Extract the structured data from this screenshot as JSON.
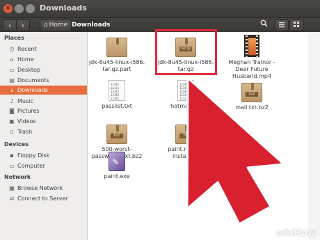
{
  "window": {
    "title": "Downloads"
  },
  "toolbar": {
    "back": "‹",
    "forward": "›",
    "breadcrumb_home": "Home",
    "breadcrumb_current": "Downloads",
    "search_icon": "search-icon",
    "list_view_icon": "list-icon",
    "grid_view_icon": "grid-icon"
  },
  "sidebar": {
    "places_heading": "Places",
    "places": [
      {
        "label": "Recent",
        "icon": "clock-icon"
      },
      {
        "label": "Home",
        "icon": "home-icon"
      },
      {
        "label": "Desktop",
        "icon": "desktop-icon"
      },
      {
        "label": "Documents",
        "icon": "documents-icon"
      },
      {
        "label": "Downloads",
        "icon": "download-icon",
        "active": true
      },
      {
        "label": "Music",
        "icon": "music-icon"
      },
      {
        "label": "Pictures",
        "icon": "pictures-icon"
      },
      {
        "label": "Videos",
        "icon": "videos-icon"
      },
      {
        "label": "Trash",
        "icon": "trash-icon"
      }
    ],
    "devices_heading": "Devices",
    "devices": [
      {
        "label": "Floppy Disk",
        "icon": "floppy-icon"
      },
      {
        "label": "Computer",
        "icon": "computer-icon"
      }
    ],
    "network_heading": "Network",
    "network": [
      {
        "label": "Browse Network",
        "icon": "network-icon"
      },
      {
        "label": "Connect to Server",
        "icon": "server-icon"
      }
    ]
  },
  "files": [
    {
      "name": "jdk-8u45-linux-i586.\ntar.gz.part",
      "type": "archive",
      "tag": ""
    },
    {
      "name": "jdk-8u45-linux-i586.\ntar.gz",
      "type": "archive",
      "tag": "tar.gz"
    },
    {
      "name": "Meghan Trainor -\nDear Future\nHusband.mp4",
      "type": "video"
    },
    {
      "name": "passlist.txt",
      "type": "text",
      "preview": "12345\npassw\n12345\n12345\n12345"
    },
    {
      "name": "hotmail.txt",
      "type": "text",
      "preview": "12345\n12345\n12345\n12345\n11111"
    },
    {
      "name": "mail.txt.bz2",
      "type": "archive",
      "tag": "bz2"
    },
    {
      "name": "500-worst-\npasswords.txt.bz2",
      "type": "archive",
      "tag": "bz2"
    },
    {
      "name": "paint.net.4.0\ninstall.zip",
      "type": "archive",
      "tag": "zip"
    },
    {
      "name": "paint.exe",
      "type": "exe"
    }
  ],
  "annotation": {
    "highlight_color": "#e22b3a",
    "arrow_color": "#d9202f"
  },
  "watermark": {
    "prefix": "wiki",
    "suffix": "How"
  }
}
